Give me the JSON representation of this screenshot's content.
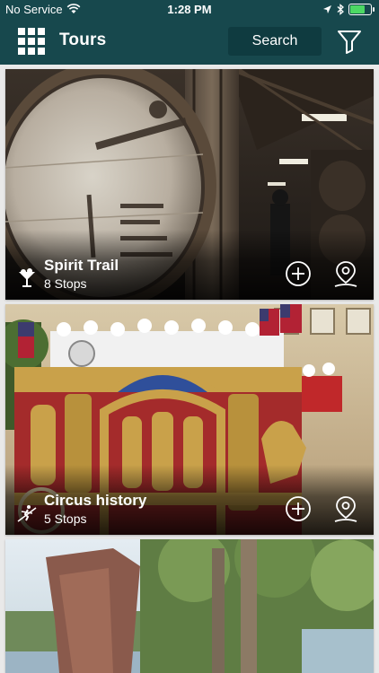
{
  "status_bar": {
    "carrier": "No Service",
    "time": "1:28 PM"
  },
  "nav": {
    "title": "Tours",
    "search_label": "Search"
  },
  "tours": [
    {
      "title": "Spirit Trail",
      "stops": "8 Stops",
      "icon": "cocktail-icon"
    },
    {
      "title": "Circus history",
      "stops": "5 Stops",
      "icon": "tightrope-walker-icon"
    }
  ],
  "colors": {
    "header": "#17484d",
    "search_bg": "#0f3b40",
    "battery": "#4cd964",
    "circus_red": "#a42b2b",
    "circus_gold": "#c9a14a"
  }
}
